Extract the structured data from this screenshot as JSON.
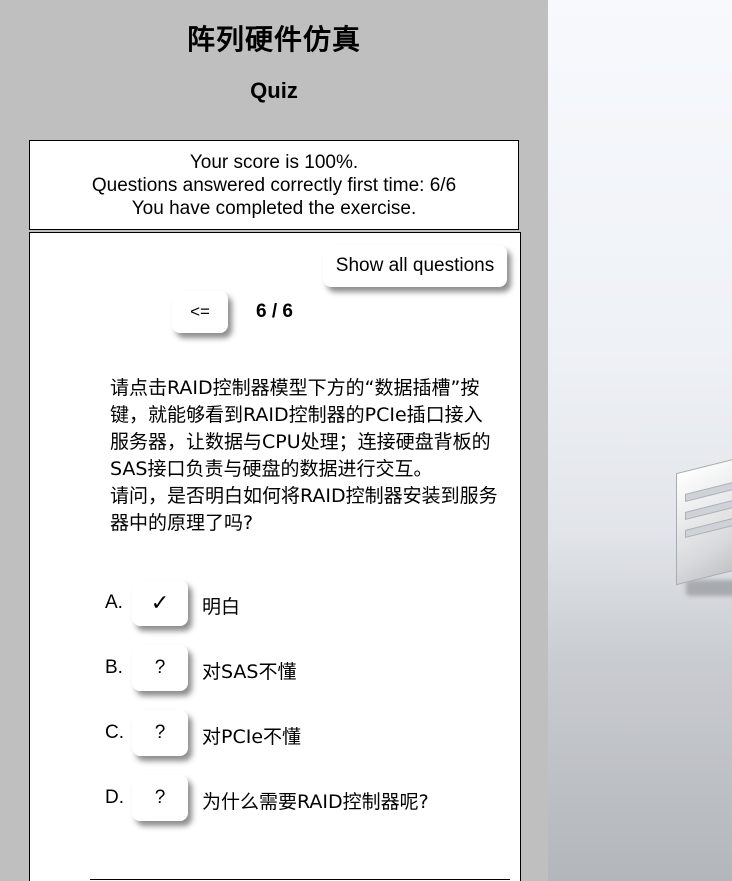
{
  "sidebar": {
    "app_title": "阵列硬件仿真",
    "quiz_title": "Quiz",
    "score": {
      "line1": "Your score is 100%.",
      "line2": "Questions answered correctly first time: 6/6",
      "line3": "You have completed the exercise."
    },
    "controls": {
      "show_all_label": "Show all questions",
      "prev_label": "<=",
      "counter": "6 / 6"
    },
    "question": {
      "paragraph1": "请点击RAID控制器模型下方的“数据插槽”按键，就能够看到RAID控制器的PCIe插口接入服务器，让数据与CPU处理；连接硬盘背板的SAS接口负责与硬盘的数据进行交互。",
      "paragraph2": "请问，是否明白如何将RAID控制器安装到服务器中的原理了吗?"
    },
    "options": [
      {
        "letter": "A.",
        "mark": "✓",
        "text": "明白",
        "selected": true
      },
      {
        "letter": "B.",
        "mark": "?",
        "text": "对SAS不懂",
        "selected": false
      },
      {
        "letter": "C.",
        "mark": "?",
        "text": "对PCIe不懂",
        "selected": false
      },
      {
        "letter": "D.",
        "mark": "?",
        "text": "为什么需要RAID控制器呢?",
        "selected": false
      }
    ]
  },
  "colors": {
    "sidebar_bg": "#bfbfbf",
    "panel_bg": "#ffffff",
    "border": "#000000"
  }
}
